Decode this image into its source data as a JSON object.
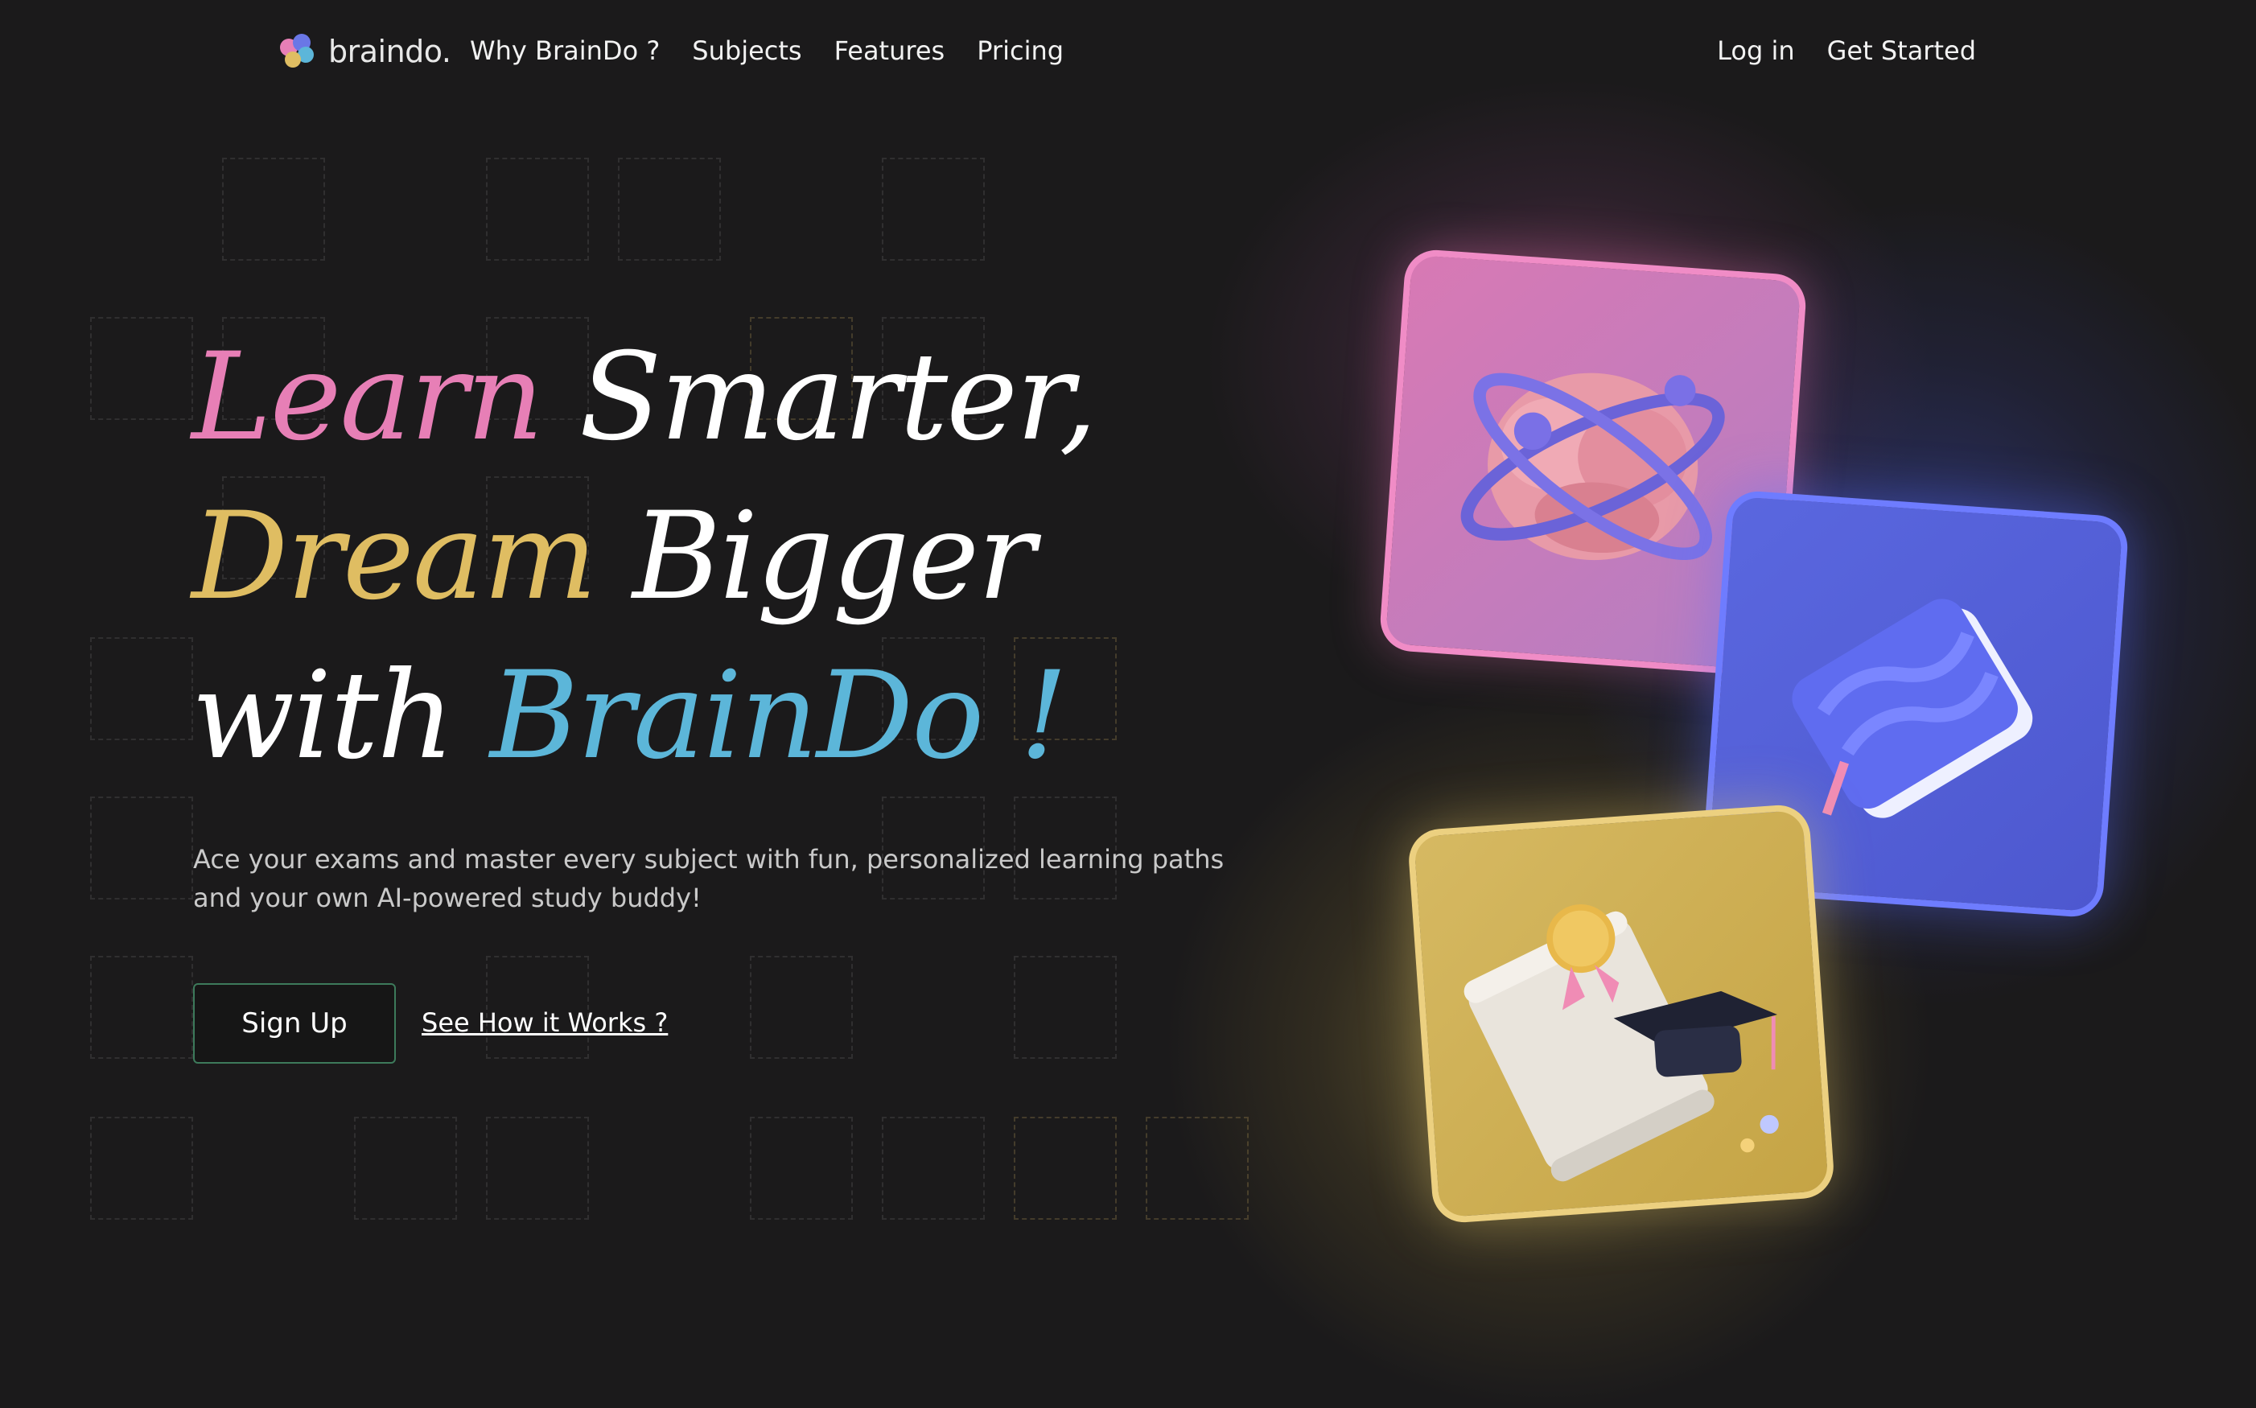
{
  "brand": {
    "name": "braindo."
  },
  "nav": {
    "links": [
      "Why BrainDo ?",
      "Subjects",
      "Features",
      "Pricing"
    ],
    "login": "Log in",
    "get_started": "Get Started"
  },
  "hero": {
    "line1": {
      "a": "Learn",
      "b": "Smarter,"
    },
    "line2": {
      "a": "Dream",
      "b": "Bigger"
    },
    "line3": {
      "a": "with",
      "b": "BrainDo !"
    },
    "subtitle": "Ace your exams and master every subject with fun, personalized learning paths and your own AI-powered study buddy!",
    "cta_primary": "Sign Up",
    "cta_secondary": "See How it Works ?"
  },
  "cards": [
    {
      "icon": "brain-icon",
      "color": "#e88cc2"
    },
    {
      "icon": "book-icon",
      "color": "#6272ea"
    },
    {
      "icon": "diploma-icon",
      "color": "#e2c36f"
    }
  ],
  "colors": {
    "background": "#1b1a1b",
    "pink": "#e77fb6",
    "gold": "#dfbd62",
    "blue": "#5cb6d9",
    "signup_border": "#3d7a5b"
  }
}
